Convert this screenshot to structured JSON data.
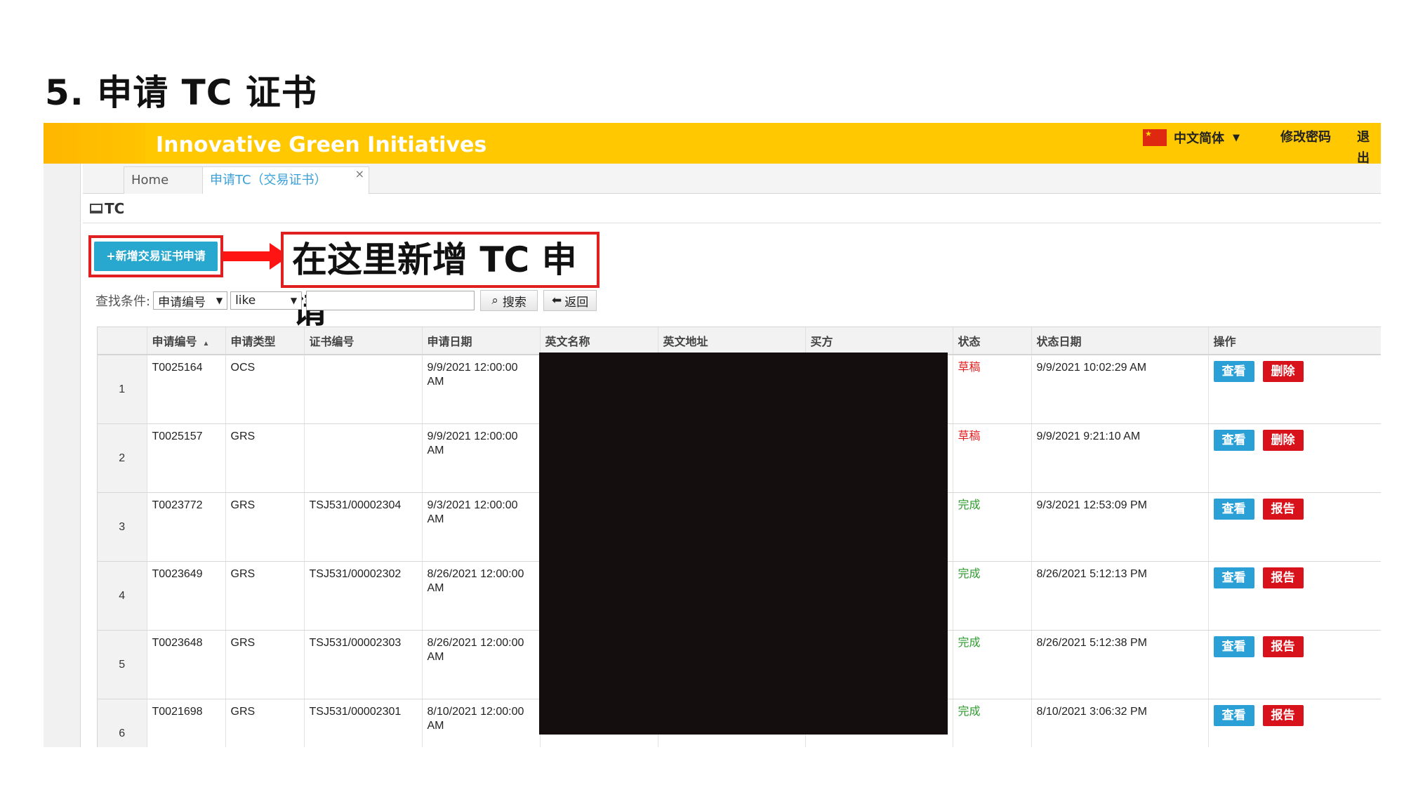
{
  "slide": {
    "title": "5. 申请 TC 证书"
  },
  "header": {
    "brand": "Innovative Green Initiatives",
    "language": "中文简体",
    "change_password": "修改密码",
    "logout": "退出"
  },
  "tabs": [
    {
      "label": "Home"
    },
    {
      "label": "申请TC（交易证书）",
      "close": "×"
    }
  ],
  "panel": {
    "title": "TC"
  },
  "toolbar": {
    "add_label": "+新增交易证书申请"
  },
  "callout": {
    "text": "在这里新增 TC 申请"
  },
  "search": {
    "label": "查找条件:",
    "field": "申请编号",
    "operator": "like",
    "value": "",
    "search_label": "搜索",
    "back_label": "返回"
  },
  "table": {
    "columns": [
      "申请编号",
      "申请类型",
      "证书编号",
      "申请日期",
      "英文名称",
      "英文地址",
      "买方",
      "状态",
      "状态日期",
      "操作"
    ],
    "rows": [
      {
        "n": "1",
        "id": "T0025164",
        "type": "OCS",
        "cert": "",
        "date": "9/9/2021 12:00:00 AM",
        "status": "草稿",
        "status_date": "9/9/2021 10:02:29 AM",
        "view": "查看",
        "action": "删除"
      },
      {
        "n": "2",
        "id": "T0025157",
        "type": "GRS",
        "cert": "",
        "date": "9/9/2021 12:00:00 AM",
        "status": "草稿",
        "status_date": "9/9/2021 9:21:10 AM",
        "view": "查看",
        "action": "删除"
      },
      {
        "n": "3",
        "id": "T0023772",
        "type": "GRS",
        "cert": "TSJ531/00002304",
        "date": "9/3/2021 12:00:00 AM",
        "status": "完成",
        "status_date": "9/3/2021 12:53:09 PM",
        "view": "查看",
        "action": "报告"
      },
      {
        "n": "4",
        "id": "T0023649",
        "type": "GRS",
        "cert": "TSJ531/00002302",
        "date": "8/26/2021 12:00:00 AM",
        "status": "完成",
        "status_date": "8/26/2021 5:12:13 PM",
        "view": "查看",
        "action": "报告"
      },
      {
        "n": "5",
        "id": "T0023648",
        "type": "GRS",
        "cert": "TSJ531/00002303",
        "date": "8/26/2021 12:00:00 AM",
        "status": "完成",
        "status_date": "8/26/2021 5:12:38 PM",
        "view": "查看",
        "action": "报告"
      },
      {
        "n": "6",
        "id": "T0021698",
        "type": "GRS",
        "cert": "TSJ531/00002301",
        "date": "8/10/2021 12:00:00 AM",
        "status": "完成",
        "status_date": "8/10/2021 3:06:32 PM",
        "view": "查看",
        "action": "报告"
      }
    ]
  },
  "colors": {
    "header": "#ffc800",
    "accent": "#28a7cf",
    "danger": "#d8121a",
    "draft": "#e02020",
    "done": "#2e9b2e"
  }
}
